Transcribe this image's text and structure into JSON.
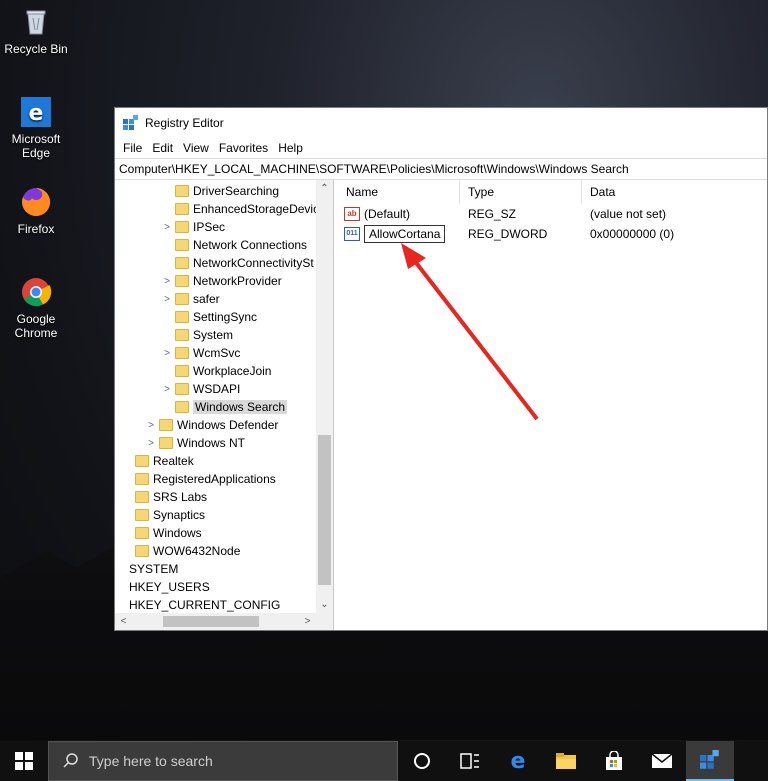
{
  "desktop": {
    "icons": [
      {
        "label": "Recycle Bin"
      },
      {
        "label": "Microsoft Edge"
      },
      {
        "label": "Firefox"
      },
      {
        "label": "Google Chrome"
      }
    ]
  },
  "window": {
    "title": "Registry Editor",
    "menu": [
      "File",
      "Edit",
      "View",
      "Favorites",
      "Help"
    ],
    "address": "Computer\\HKEY_LOCAL_MACHINE\\SOFTWARE\\Policies\\Microsoft\\Windows\\Windows Search",
    "tree": [
      {
        "label": "DriverSearching",
        "expander": ""
      },
      {
        "label": "EnhancedStorageDevic",
        "expander": ""
      },
      {
        "label": "IPSec",
        "expander": ">"
      },
      {
        "label": "Network Connections",
        "expander": ""
      },
      {
        "label": "NetworkConnectivitySt",
        "expander": ""
      },
      {
        "label": "NetworkProvider",
        "expander": ">"
      },
      {
        "label": "safer",
        "expander": ">"
      },
      {
        "label": "SettingSync",
        "expander": ""
      },
      {
        "label": "System",
        "expander": ""
      },
      {
        "label": "WcmSvc",
        "expander": ">"
      },
      {
        "label": "WorkplaceJoin",
        "expander": ""
      },
      {
        "label": "WSDAPI",
        "expander": ">"
      },
      {
        "label": "Windows Search",
        "expander": "",
        "selected": true
      },
      {
        "label": "Windows Defender",
        "expander": ">"
      },
      {
        "label": "Windows NT",
        "expander": ">"
      },
      {
        "label": "Realtek",
        "expander": ""
      },
      {
        "label": "RegisteredApplications",
        "expander": ""
      },
      {
        "label": "SRS Labs",
        "expander": ""
      },
      {
        "label": "Synaptics",
        "expander": ""
      },
      {
        "label": "Windows",
        "expander": ""
      },
      {
        "label": "WOW6432Node",
        "expander": ""
      },
      {
        "label": "SYSTEM",
        "expander": ""
      },
      {
        "label": "HKEY_USERS",
        "expander": ""
      },
      {
        "label": "HKEY_CURRENT_CONFIG",
        "expander": ""
      }
    ],
    "columns": [
      "Name",
      "Type",
      "Data"
    ],
    "values": [
      {
        "name": "(Default)",
        "type": "REG_SZ",
        "data": "(value not set)",
        "icon": "string-value-icon",
        "glyph": "ab"
      },
      {
        "name": "AllowCortana",
        "type": "REG_DWORD",
        "data": "0x00000000 (0)",
        "icon": "dword-value-icon",
        "glyph": "011"
      }
    ]
  },
  "taskbar": {
    "search_placeholder": "Type here to search"
  },
  "colors": {
    "arrow": "#e8251f",
    "folder": "#f7d774",
    "taskbar": "#101010"
  }
}
